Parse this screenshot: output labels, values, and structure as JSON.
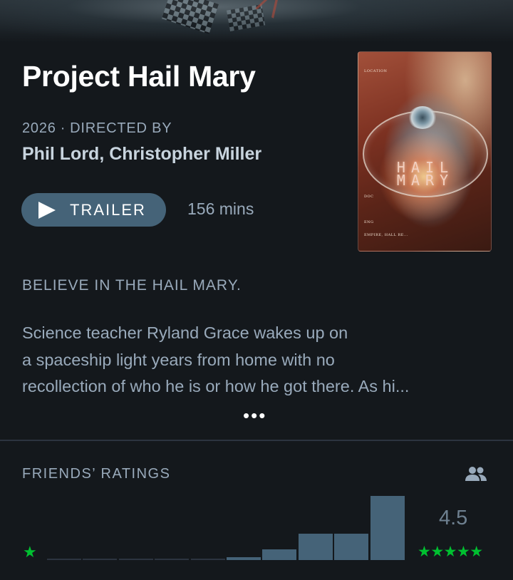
{
  "film": {
    "title": "Project Hail Mary",
    "year": "2026",
    "directed_by_label": "DIRECTED BY",
    "directors": "Phil Lord, Christopher Miller",
    "trailer_label": "TRAILER",
    "runtime": "156 mins",
    "tagline": "BELIEVE IN THE HAIL MARY.",
    "synopsis_lines": [
      "Science teacher Ryland Grace wakes up on",
      "a spaceship light years from home with no",
      "recollection of who he is or how he got there. As hi..."
    ],
    "more_label": "•••"
  },
  "poster": {
    "title_top": "HAIL",
    "title_bottom": "MARY",
    "small_texts": [
      "LOCATION",
      "DOC",
      "ENG",
      "EMPIRE, HALL RE..."
    ]
  },
  "ratings": {
    "title": "FRIENDS’ RATINGS",
    "average": "4.5",
    "low_label": "★",
    "high_label": "★★★★★",
    "icon": "friends-icon",
    "accent": "#00c030",
    "bar_color": "#456378",
    "empty_color": "#2c3440"
  },
  "chart_data": {
    "type": "bar",
    "categories": [
      "0.5",
      "1",
      "1.5",
      "2",
      "2.5",
      "3",
      "3.5",
      "4",
      "4.5",
      "5"
    ],
    "values": [
      0,
      0,
      0,
      0,
      0,
      2,
      7,
      17,
      17,
      41
    ],
    "title": "FRIENDS’ RATINGS",
    "xlabel": "",
    "ylabel": "",
    "grid": false
  }
}
